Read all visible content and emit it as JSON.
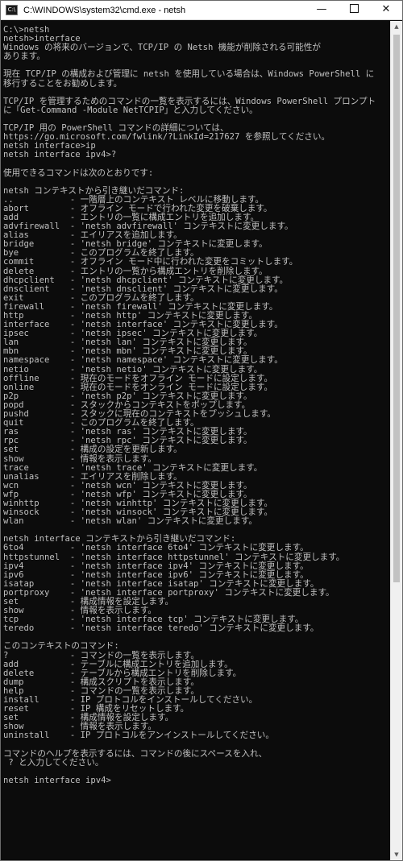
{
  "window": {
    "title": "C:\\WINDOWS\\system32\\cmd.exe - netsh",
    "icon_text": "C:\\",
    "minimize_glyph": "—",
    "close_glyph": "✕"
  },
  "console": {
    "lines": [
      "C:\\>netsh",
      "netsh>interface",
      "Windows の将来のバージョンで、TCP/IP の Netsh 機能が削除される可能性が",
      "あります。",
      "",
      "現在 TCP/IP の構成および管理に netsh を使用している場合は、Windows PowerShell に",
      "移行することをお勧めします。",
      "",
      "TCP/IP を管理するためのコマンドの一覧を表示するには、Windows PowerShell プロンプト",
      "に「Get-Command -Module NetTCPIP」と入力してください。",
      "",
      "TCP/IP 用の PowerShell コマンドの詳細については、",
      "https://go.microsoft.com/fwlink/?LinkId=217627 を参照してください。",
      "netsh interface>ip",
      "netsh interface ipv4>?",
      "",
      "使用できるコマンドは次のとおりです:",
      "",
      "netsh コンテキストから引き継いだコマンド:",
      "..           - 一階層上のコンテキスト レベルに移動します。",
      "abort        - オフライン モードで行われた変更を破棄します。",
      "add          - エントリの一覧に構成エントリを追加します。",
      "advfirewall  - 'netsh advfirewall' コンテキストに変更します。",
      "alias        - エイリアスを追加します。",
      "bridge       - 'netsh bridge' コンテキストに変更します。",
      "bye          - このプログラムを終了します。",
      "commit       - オフライン モード中に行われた変更をコミットします。",
      "delete       - エントリの一覧から構成エントリを削除します。",
      "dhcpclient   - 'netsh dhcpclient' コンテキストに変更します。",
      "dnsclient    - 'netsh dnsclient' コンテキストに変更します。",
      "exit         - このプログラムを終了します。",
      "firewall     - 'netsh firewall' コンテキストに変更します。",
      "http         - 'netsh http' コンテキストに変更します。",
      "interface    - 'netsh interface' コンテキストに変更します。",
      "ipsec        - 'netsh ipsec' コンテキストに変更します。",
      "lan          - 'netsh lan' コンテキストに変更します。",
      "mbn          - 'netsh mbn' コンテキストに変更します。",
      "namespace    - 'netsh namespace' コンテキストに変更します。",
      "netio        - 'netsh netio' コンテキストに変更します。",
      "offline      - 現在のモードをオフライン モードに設定します。",
      "online       - 現在のモードをオンライン モードに設定します。",
      "p2p          - 'netsh p2p' コンテキストに変更します。",
      "popd         - スタックからコンテキストをポップします。",
      "pushd        - スタックに現在のコンテキストをプッシュします。",
      "quit         - このプログラムを終了します。",
      "ras          - 'netsh ras' コンテキストに変更します。",
      "rpc          - 'netsh rpc' コンテキストに変更します。",
      "set          - 構成の設定を更新します。",
      "show         - 情報を表示します。",
      "trace        - 'netsh trace' コンテキストに変更します。",
      "unalias      - エイリアスを削除します。",
      "wcn          - 'netsh wcn' コンテキストに変更します。",
      "wfp          - 'netsh wfp' コンテキストに変更します。",
      "winhttp      - 'netsh winhttp' コンテキストに変更します。",
      "winsock      - 'netsh winsock' コンテキストに変更します。",
      "wlan         - 'netsh wlan' コンテキストに変更します。",
      "",
      "netsh interface コンテキストから引き継いだコマンド:",
      "6to4         - 'netsh interface 6to4' コンテキストに変更します。",
      "httpstunnel  - 'netsh interface httpstunnel' コンテキストに変更します。",
      "ipv4         - 'netsh interface ipv4' コンテキストに変更します。",
      "ipv6         - 'netsh interface ipv6' コンテキストに変更します。",
      "isatap       - 'netsh interface isatap' コンテキストに変更します。",
      "portproxy    - 'netsh interface portproxy' コンテキストに変更します。",
      "set          - 構成情報を設定します。",
      "show         - 情報を表示します。",
      "tcp          - 'netsh interface tcp' コンテキストに変更します。",
      "teredo       - 'netsh interface teredo' コンテキストに変更します。",
      "",
      "このコンテキストのコマンド:",
      "?            - コマンドの一覧を表示します。",
      "add          - テーブルに構成エントリを追加します。",
      "delete       - テーブルから構成エントリを削除します。",
      "dump         - 構成スクリプトを表示します。",
      "help         - コマンドの一覧を表示します。",
      "install      - IP プロトコルをインストールしてください。",
      "reset        - IP 構成をリセットします。",
      "set          - 構成情報を設定します。",
      "show         - 情報を表示します。",
      "uninstall    - IP プロトコルをアンインストールしてください。",
      "",
      "コマンドのヘルプを表示するには、コマンドの後にスペースを入れ、",
      " ? と入力してください。",
      "",
      "netsh interface ipv4>"
    ]
  }
}
